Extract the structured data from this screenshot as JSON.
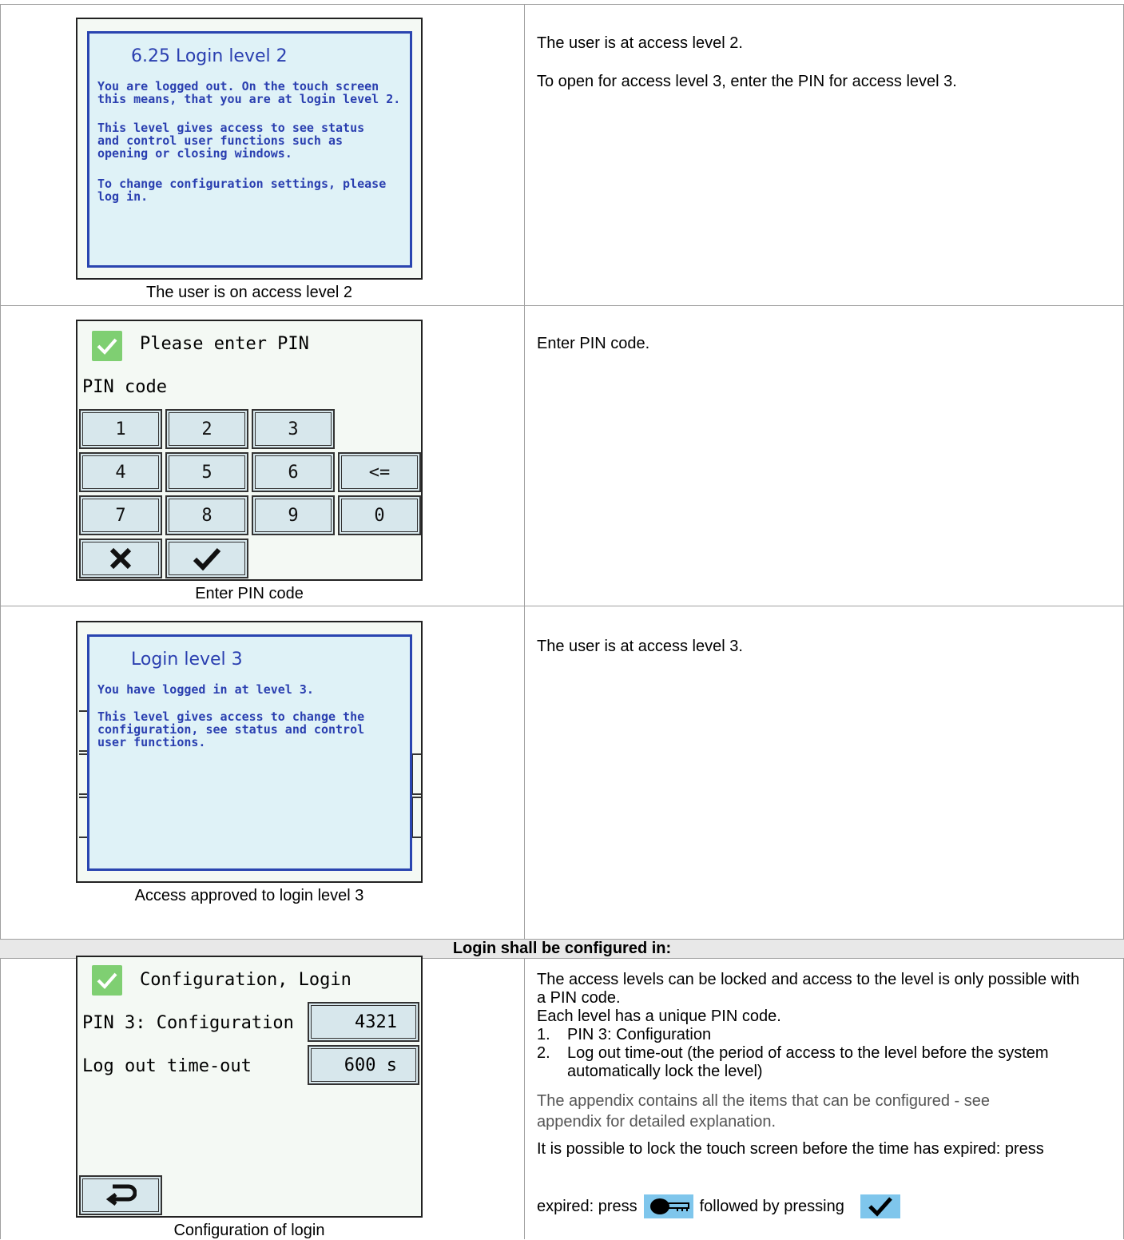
{
  "rows": [
    {
      "caption": "The user is on access level 2",
      "popup": {
        "title": "6.25 Login level 2",
        "text1": "You are logged out. On the touch screen this means, that you are at login level 2.",
        "text2": "This level gives access to see status and control user functions such as opening or closing windows.",
        "text3": "To change configuration settings, please log in."
      },
      "desc1": "The user is at access level 2.",
      "desc2": "To open for access level 3, enter the PIN for access level 3."
    },
    {
      "caption": "Enter PIN code",
      "screen_title": "Please enter PIN",
      "field_label": "PIN code",
      "keys": [
        "1",
        "2",
        "3",
        "4",
        "5",
        "6",
        "<=",
        "7",
        "8",
        "9",
        "0"
      ],
      "desc1": "Enter PIN code."
    },
    {
      "caption": "Access approved to login level 3",
      "popup": {
        "title": "Login level 3",
        "text1": "You have logged in at level 3.",
        "text2": "This level gives access to change the configuration, see status and control user functions."
      },
      "desc1": "The user is at access level 3."
    }
  ],
  "section_header": "Login shall be configured in:",
  "config": {
    "caption": "Configuration of login",
    "screen_title": "Configuration, Login",
    "pin_label": "PIN 3: Configuration",
    "pin_value": "4321",
    "timeout_label": "Log out time-out",
    "timeout_value": "600 s",
    "desc_intro": "The access levels can be locked and access to the level is only possible with a PIN code.",
    "desc_unique": "Each level has a unique PIN code.",
    "list1": "PIN 3: Configuration",
    "list2": "Log out time-out (the period of access to the level before the system automatically lock the level)",
    "appendix": "The appendix contains all the items that can be configured - see appendix for detailed explanation.",
    "lock_text_a": "It is possible to lock the touch screen before the time has expired: press",
    "lock_text_b": "followed by pressing"
  },
  "icons": [
    "check-icon",
    "cross-icon",
    "checkmark-icon",
    "back-arrow-icon",
    "key-icon"
  ]
}
